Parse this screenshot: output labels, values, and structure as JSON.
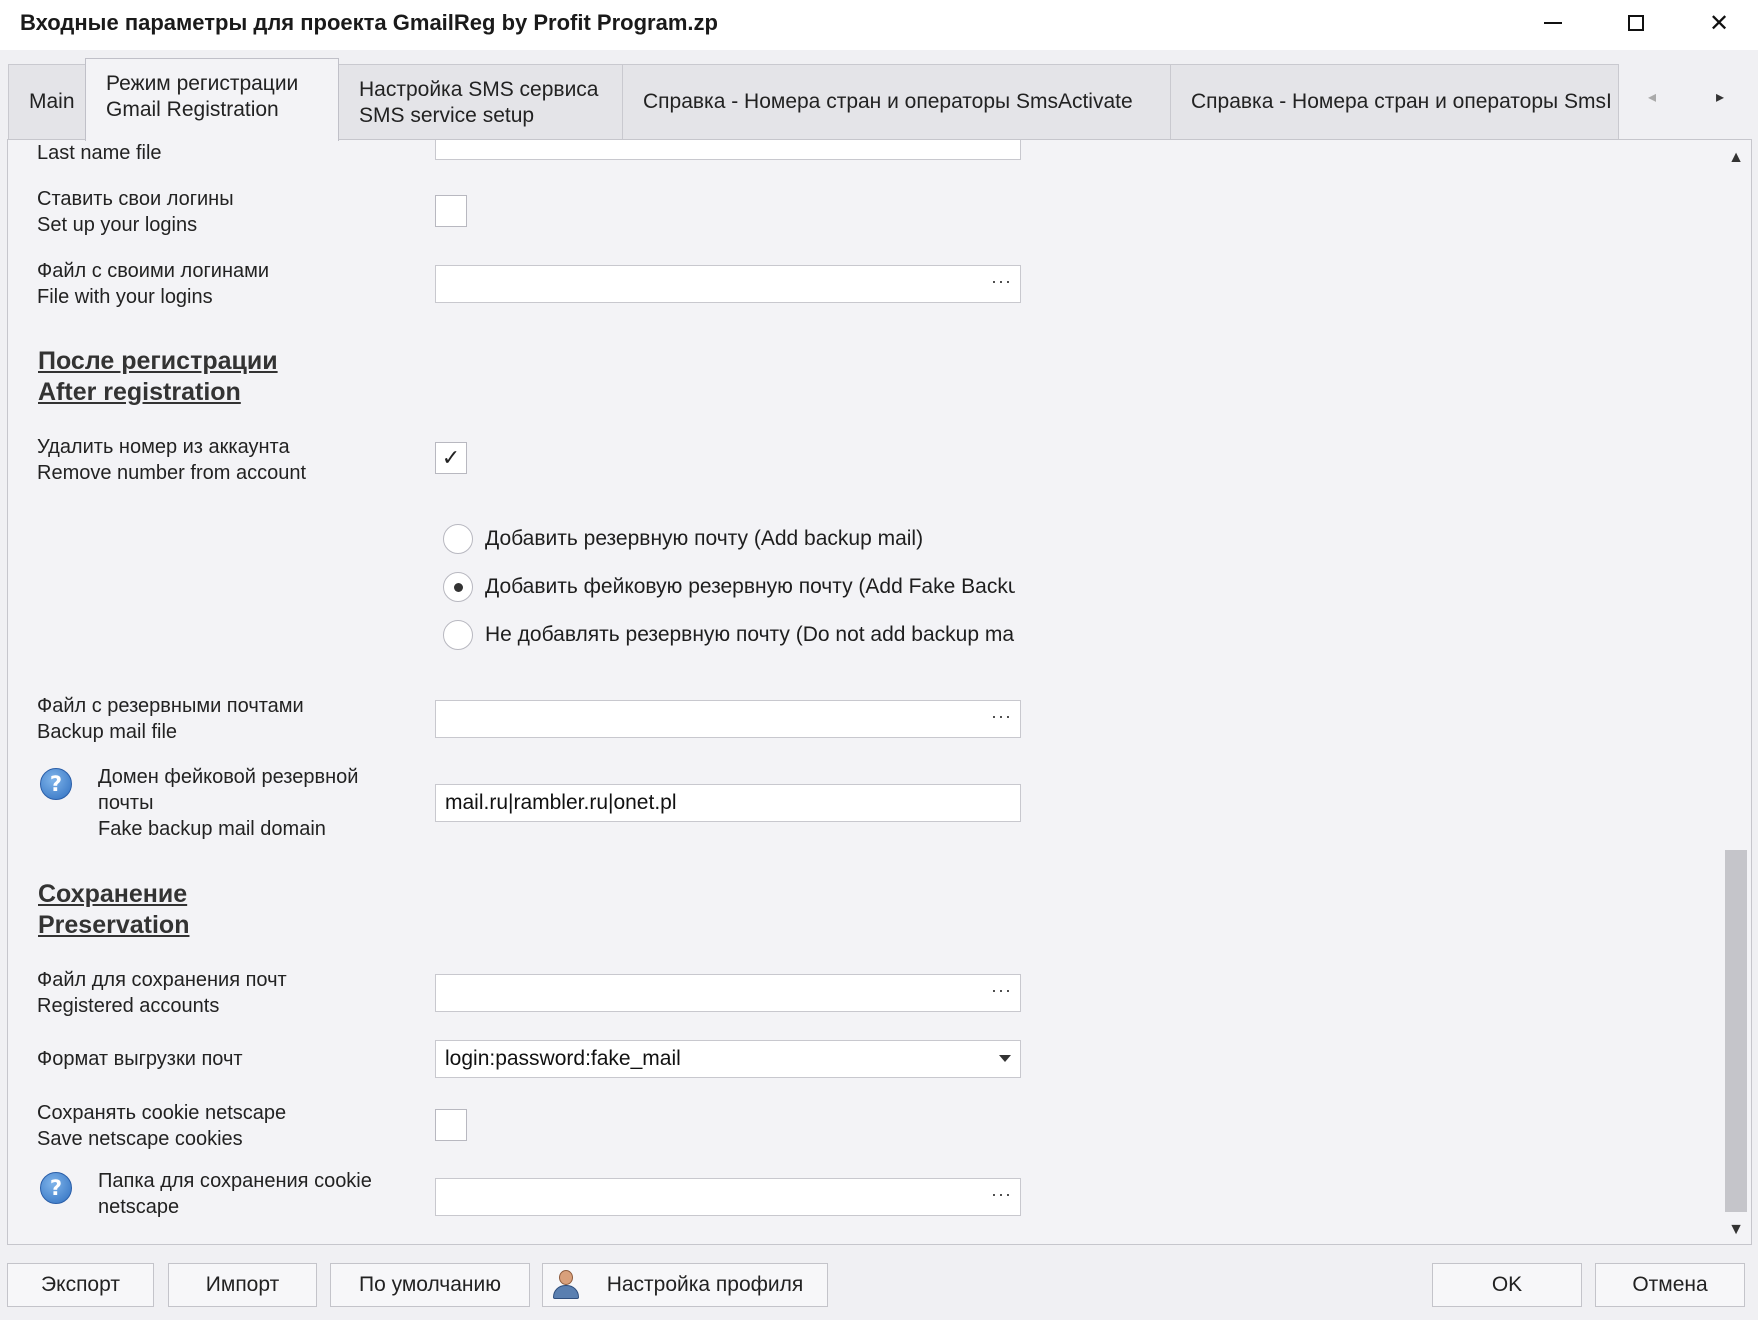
{
  "window": {
    "title": "Входные параметры для проекта GmailReg by Profit Program.zp",
    "minimize_icon": "minimize-icon",
    "maximize_icon": "maximize-icon",
    "close_label": "✕"
  },
  "tabs": [
    {
      "line1": "Main",
      "line2": ""
    },
    {
      "line1": "Режим регистрации",
      "line2": "Gmail Registration",
      "active": true
    },
    {
      "line1": "Настройка SMS сервиса",
      "line2": "SMS service setup"
    },
    {
      "line1": "Справка - Номера стран и операторы SmsActivate",
      "line2": ""
    },
    {
      "line1": "Справка - Номера стран и операторы SmsI",
      "line2": ""
    }
  ],
  "tab_nav": {
    "left": "◂",
    "right": "▸"
  },
  "form": {
    "last_name_file": {
      "label": "Last name file",
      "value": ""
    },
    "set_logins": {
      "label1": "Ставить свои логины",
      "label2": "Set up your logins",
      "checked": false
    },
    "logins_file": {
      "label1": "Файл с своими логинами",
      "label2": "File with your logins",
      "value": ""
    },
    "section_after": {
      "line1": "После регистрации",
      "line2": "After registration"
    },
    "remove_number": {
      "label1": "Удалить номер из аккаунта",
      "label2": "Remove number from account",
      "check_mark": "✓"
    },
    "backup_options": [
      {
        "label": "Добавить резервную почту (Add backup mail)",
        "selected": false
      },
      {
        "label": "Добавить фейковую резервную почту (Add Fake Backup mail)",
        "selected": true
      },
      {
        "label": "Не добавлять резервную почту (Do not add backup mail)",
        "selected": false
      }
    ],
    "backup_file": {
      "label1": "Файл с резервными почтами",
      "label2": "Backup mail file",
      "value": ""
    },
    "fake_domain": {
      "label1": "Домен фейковой резервной",
      "label2": "почты",
      "label3": "Fake backup mail domain",
      "value": "mail.ru|rambler.ru|onet.pl",
      "help": "?"
    },
    "section_save": {
      "line1": "Сохранение",
      "line2": "Preservation"
    },
    "save_file": {
      "label1": "Файл для сохранения почт",
      "label2": "Registered accounts",
      "value": ""
    },
    "export_format": {
      "label": "Формат выгрузки почт",
      "value": "login:password:fake_mail"
    },
    "save_cookies": {
      "label1": "Сохранять cookie netscape",
      "label2": "Save netscape cookies",
      "checked": false
    },
    "cookie_folder": {
      "label1": "Папка для сохранения cookie",
      "label2": "netscape",
      "value": "",
      "help": "?"
    },
    "browse_dots": "···"
  },
  "scroll": {
    "up": "▲",
    "down": "▼"
  },
  "buttons": {
    "export": "Экспорт",
    "import": "Импорт",
    "defaults": "По умолчанию",
    "profile": "Настройка профиля",
    "ok": "OK",
    "cancel": "Отмена"
  }
}
